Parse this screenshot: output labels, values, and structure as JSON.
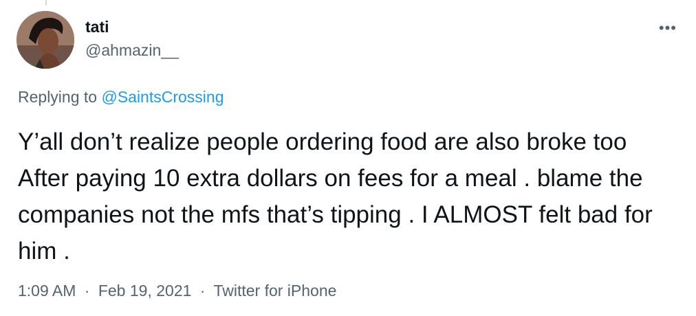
{
  "tweet": {
    "author_name": "tati",
    "author_handle": "@ahmazin__",
    "more_label": "•••",
    "replying_prefix": "Replying to",
    "replying_to": "@SaintsCrossing",
    "text": "Y’all don’t realize people ordering food are also broke too After paying 10 extra dollars on fees for a meal . blame the companies not the mfs that’s tipping . I ALMOST felt bad for him .",
    "time": "1:09 AM",
    "date": "Feb 19, 2021",
    "source": "Twitter for iPhone",
    "separator": "·"
  },
  "colors": {
    "text_primary": "#0f1419",
    "text_secondary": "#536471",
    "link": "#1d9bf0"
  }
}
